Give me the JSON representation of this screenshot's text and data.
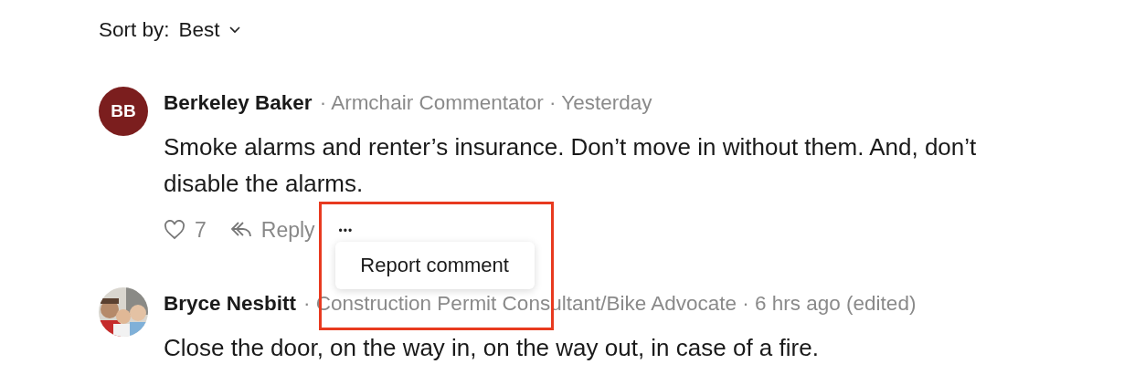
{
  "sort": {
    "label": "Sort by:",
    "value": "Best"
  },
  "comments": [
    {
      "avatar": {
        "kind": "initials",
        "initials": "BB",
        "color": "#7b1e1e"
      },
      "author": "Berkeley Baker",
      "meta": "· Armchair Commentator · Yesterday",
      "text": "Smoke alarms and renter’s insurance. Don’t move in without them. And, don’t disable the alarms.",
      "actions": {
        "likes": "7",
        "reply": "Reply",
        "more": "•••"
      },
      "menu_open": true
    },
    {
      "author": "Bryce Nesbitt",
      "meta": "· Construction Permit Consultant/Bike Advocate · 6 hrs ago (edited)",
      "text": "Close the door, on the way in, on the way out, in case of a fire.",
      "menu_open": false
    }
  ],
  "menu": {
    "items": [
      "Report comment"
    ]
  }
}
